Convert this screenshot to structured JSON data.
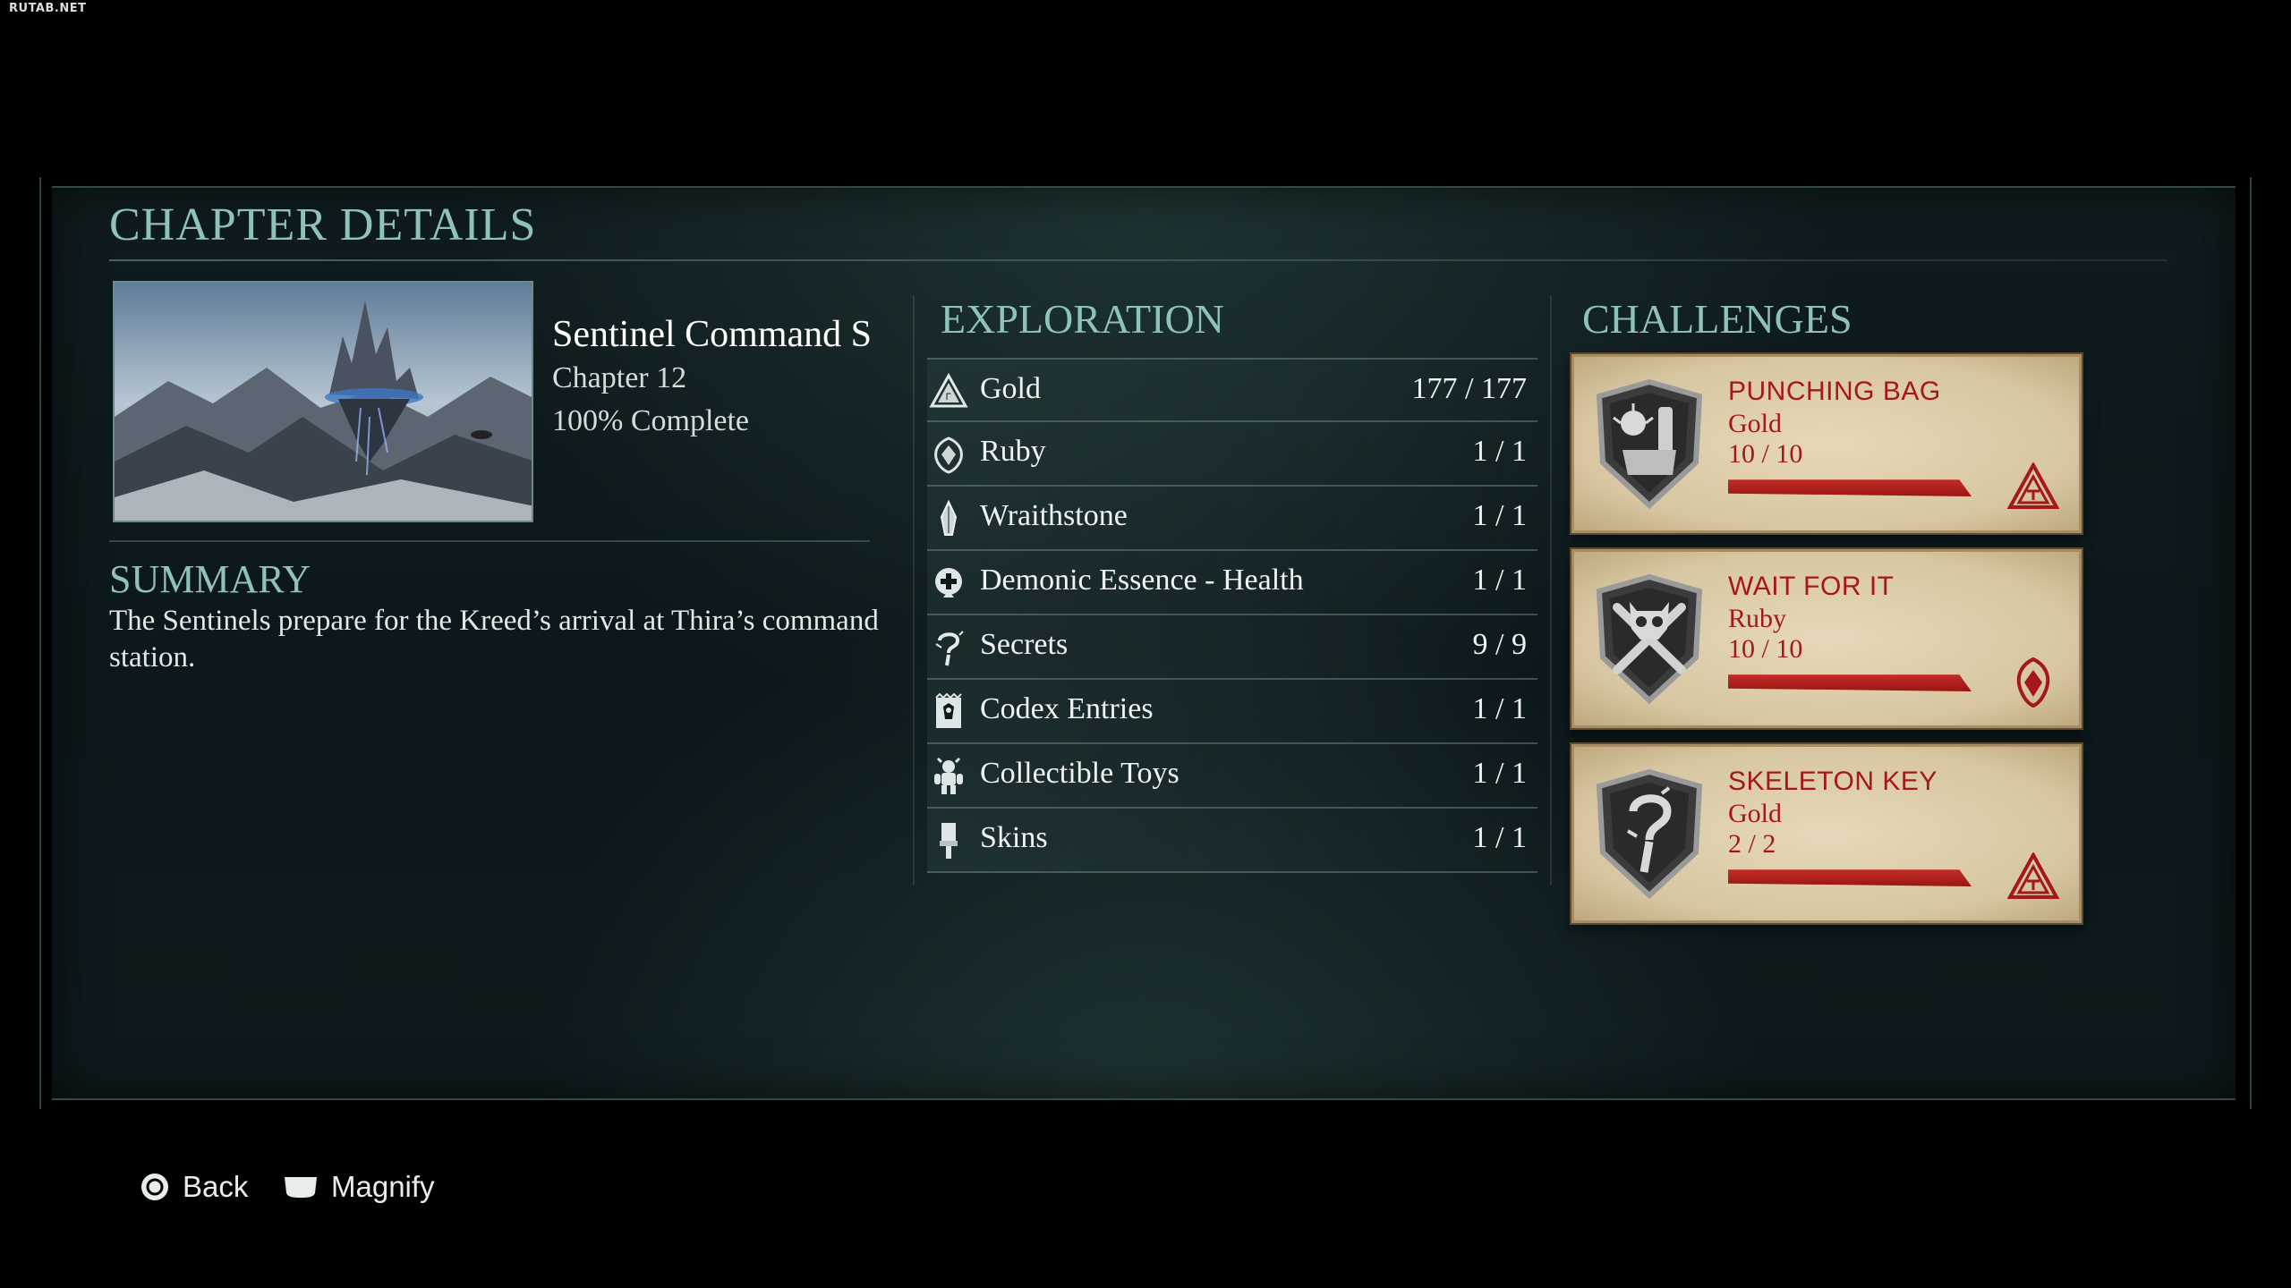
{
  "watermark": "RUTAB.NET",
  "page_title": "CHAPTER DETAILS",
  "chapter": {
    "name": "Sentinel Command S",
    "number": "Chapter 12",
    "completion": "100% Complete"
  },
  "summary": {
    "heading": "SUMMARY",
    "text": "The Sentinels prepare for the Kreed’s arrival at Thira’s command station."
  },
  "exploration": {
    "heading": "EXPLORATION",
    "items": [
      {
        "label": "Gold",
        "count": "177 / 177",
        "icon": "gold-triangle-icon"
      },
      {
        "label": "Ruby",
        "count": "1 / 1",
        "icon": "ruby-icon"
      },
      {
        "label": "Wraithstone",
        "count": "1 / 1",
        "icon": "wraithstone-icon"
      },
      {
        "label": "Demonic Essence - Health",
        "count": "1 / 1",
        "icon": "demonic-essence-health-icon"
      },
      {
        "label": "Secrets",
        "count": "9 / 9",
        "icon": "secret-question-icon"
      },
      {
        "label": "Codex Entries",
        "count": "1 / 1",
        "icon": "codex-icon"
      },
      {
        "label": "Collectible Toys",
        "count": "1 / 1",
        "icon": "toy-figure-icon"
      },
      {
        "label": "Skins",
        "count": "1 / 1",
        "icon": "skin-brush-icon"
      }
    ]
  },
  "challenges": {
    "heading": "CHALLENGES",
    "items": [
      {
        "title": "PUNCHING BAG",
        "tier": "Gold",
        "progress": "10 / 10",
        "progress_fraction": 1.0,
        "badge": "fist-shield-icon",
        "reward": "gold-reward-icon"
      },
      {
        "title": "WAIT FOR IT",
        "tier": "Ruby",
        "progress": "10 / 10",
        "progress_fraction": 1.0,
        "badge": "skull-crossbones-shield-icon",
        "reward": "ruby-reward-icon"
      },
      {
        "title": "SKELETON KEY",
        "tier": "Gold",
        "progress": "2 / 2",
        "progress_fraction": 1.0,
        "badge": "question-key-shield-icon",
        "reward": "gold-reward-icon"
      }
    ]
  },
  "footer": {
    "back_label": "Back",
    "magnify_label": "Magnify"
  },
  "colors": {
    "heading_teal": "#8fc2bc",
    "challenge_red": "#a5171b",
    "card_parchment": "#d7c6a1"
  }
}
